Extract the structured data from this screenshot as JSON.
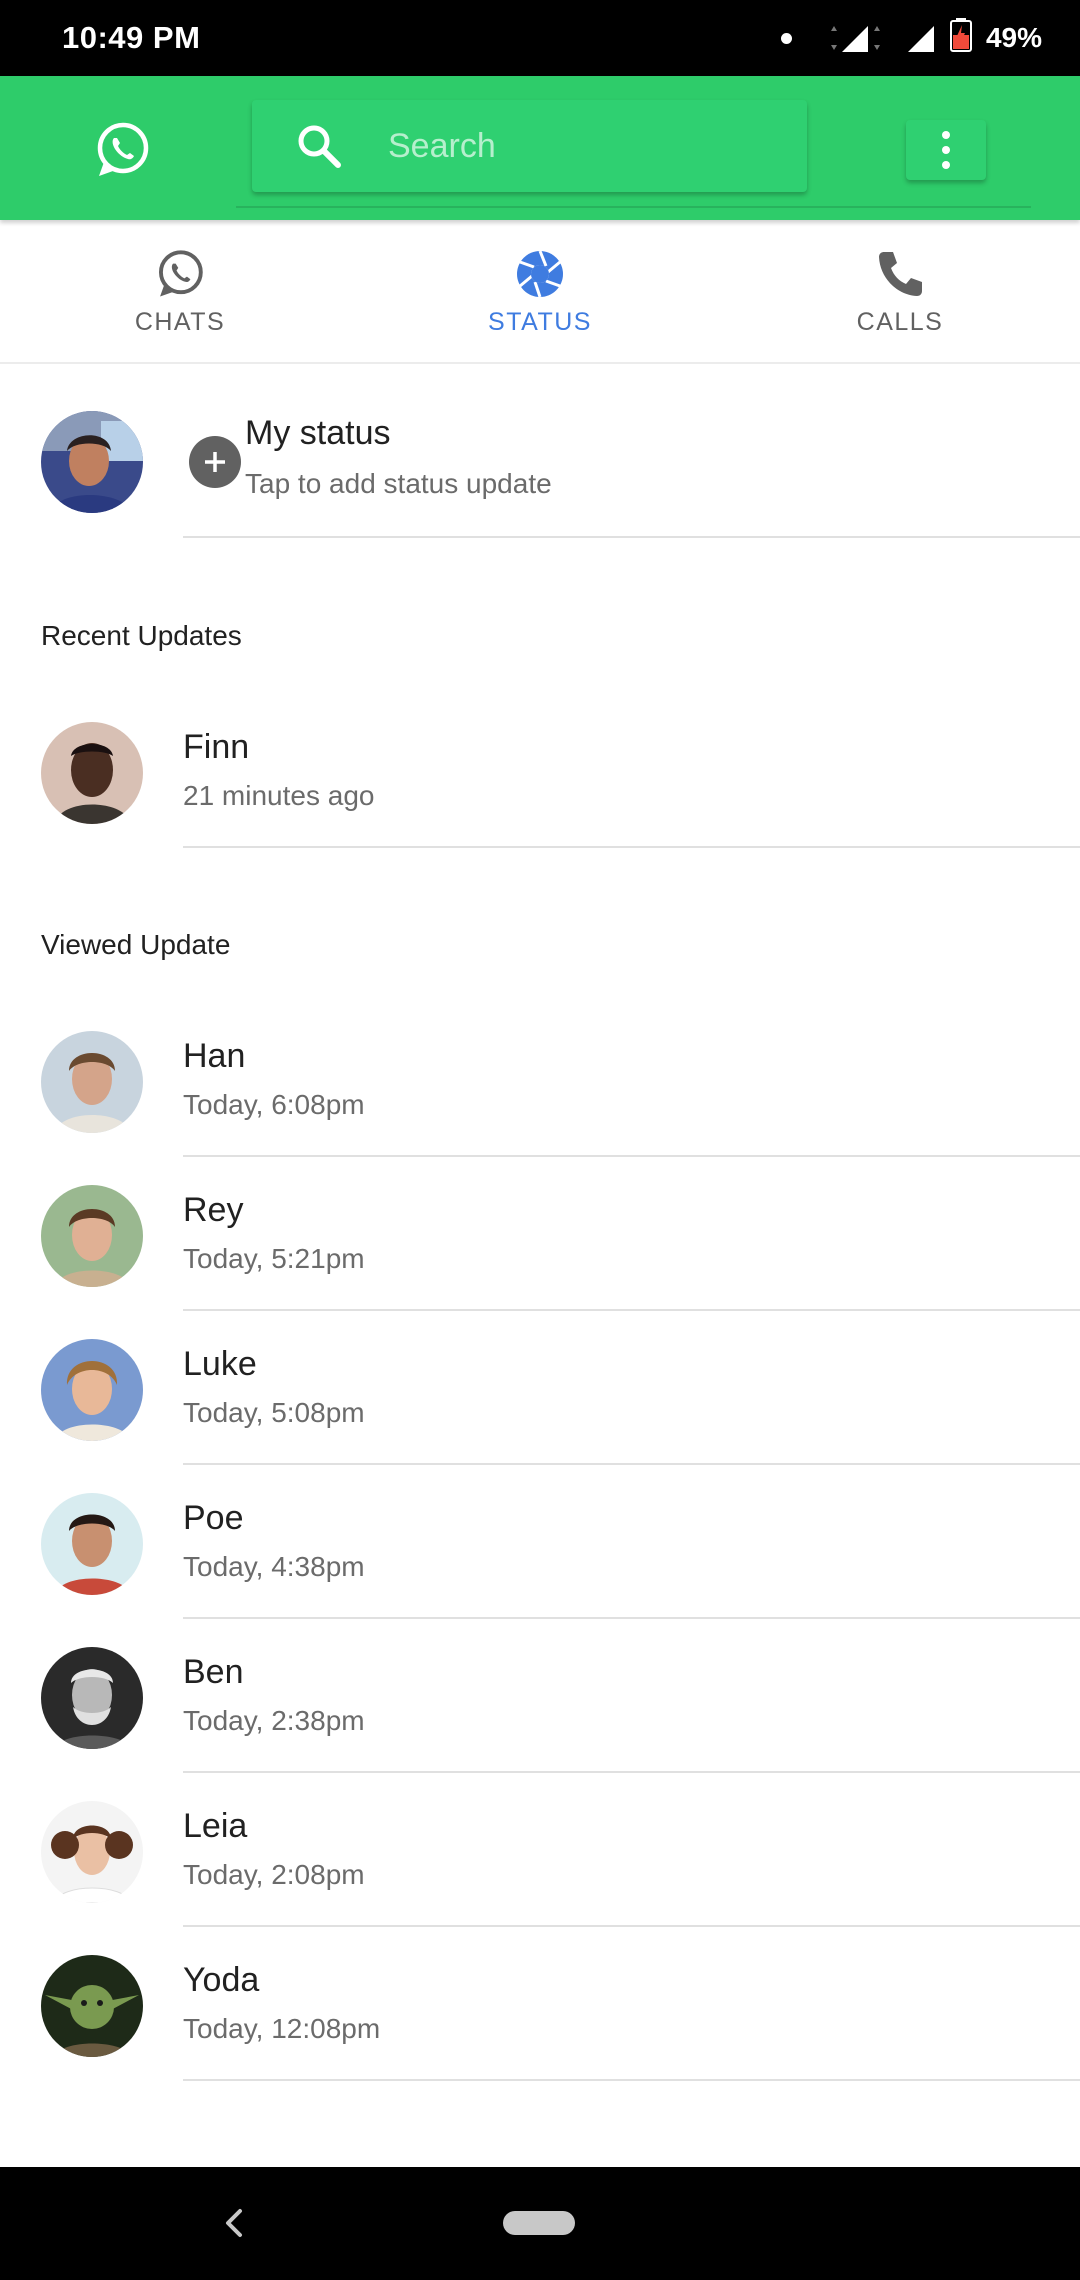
{
  "status_bar": {
    "time": "10:49 PM",
    "battery": "49%"
  },
  "header": {
    "search_placeholder": "Search"
  },
  "tabs": [
    {
      "label": "CHATS",
      "icon": "whatsapp-icon",
      "active": false
    },
    {
      "label": "STATUS",
      "icon": "camera-shutter-icon",
      "active": true
    },
    {
      "label": "CALLS",
      "icon": "phone-icon",
      "active": false
    }
  ],
  "my_status": {
    "title": "My status",
    "subtitle": "Tap to add status update"
  },
  "recent": {
    "title": "Recent Updates",
    "items": [
      {
        "name": "Finn",
        "time": "21 minutes ago"
      }
    ]
  },
  "viewed": {
    "title": "Viewed Update",
    "items": [
      {
        "name": "Han",
        "time": "Today, 6:08pm"
      },
      {
        "name": "Rey",
        "time": "Today, 5:21pm"
      },
      {
        "name": "Luke",
        "time": "Today, 5:08pm"
      },
      {
        "name": "Poe",
        "time": "Today, 4:38pm"
      },
      {
        "name": "Ben",
        "time": "Today, 2:38pm"
      },
      {
        "name": "Leia",
        "time": "Today, 2:08pm"
      },
      {
        "name": "Yoda",
        "time": "Today, 12:08pm"
      }
    ]
  },
  "colors": {
    "header_green": "#2ecc6a",
    "active_tab_blue": "#3f7ce0"
  }
}
